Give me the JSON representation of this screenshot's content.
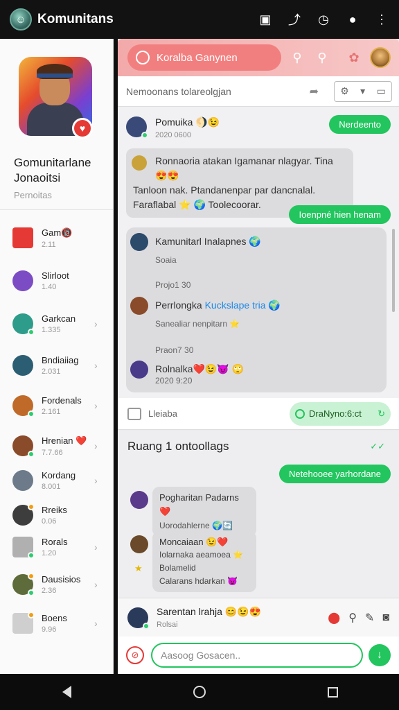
{
  "topbar": {
    "title": "Komunitans",
    "icons": [
      "camera-icon",
      "upload-icon",
      "timer-icon",
      "notification-icon",
      "more-icon"
    ]
  },
  "sidebar": {
    "profile_name": "Gomunitarlane Jonaoitsi",
    "profile_sub": "Pernoitas",
    "items": [
      {
        "name": "Gam🔞",
        "sub": "2.11",
        "color": "#e53935"
      },
      {
        "name": "Slirloot",
        "sub": "1.40",
        "color": "#7b4cc4"
      },
      {
        "name": "Garkcan",
        "sub": "1.335",
        "color": "#2e9c8a"
      },
      {
        "name": "Bndiaiiag",
        "sub": "2.031",
        "color": "#2c5e73"
      },
      {
        "name": "Fordenals",
        "sub": "2.161",
        "color": "#c06a2a"
      },
      {
        "name": "Hrenian ❤️",
        "sub": "7.7.66",
        "color": "#8a4b2a"
      },
      {
        "name": "Kordang",
        "sub": "8.001",
        "color": "#6c7a8a"
      },
      {
        "name": "Rreiks",
        "sub": "0.06",
        "color": "#3d3d3d"
      },
      {
        "name": "Rorals",
        "sub": "1.20",
        "color": "#a0a0a0"
      },
      {
        "name": "Dausisios",
        "sub": "2.36",
        "color": "#5e6b3a"
      },
      {
        "name": "Boens",
        "sub": "9.96",
        "color": "#b7b7b7"
      }
    ]
  },
  "main": {
    "search_text": "Koralba Ganynen",
    "filter_text": "Nemoonans tolareolgjan",
    "feed": {
      "msg1_sender": "Pomuika",
      "msg1_emoji": "🌖😉",
      "msg1_time": "2020 0600",
      "msg1_reply": "Nerdeento",
      "msg2_line1": "Ronnaoria atakan Igamanar nlagyar. Tina 😍😍",
      "msg2_line2": "Tanloon nak. Ptandanenpar par dancnalal.",
      "msg2_line3": "Faraflabal ⭐ 🌍 Toolecoorar.",
      "msg3_reply": "Ioenpné hien henam",
      "thread": {
        "title": "Kamunitarl Inalapnes 🌍",
        "title_sub": "Soaia",
        "time1": "Projo1 30",
        "sender2": "Perrlongka",
        "sender2_link": "Kuckslape tria",
        "sender2_emoji": "🌍",
        "sender2_sub": "Sanealiar nenpitarn ⭐",
        "time2": "Praon7 30",
        "sender3": "Rolnalka❤️😉😈",
        "sender3_emoji": "🙄",
        "sender3_time": "2020 9:20"
      },
      "reply_label": "Lleiaba",
      "reply_pill": "DraNyno:6:ct"
    },
    "room": {
      "title": "Ruang 1 ontoollags",
      "check": "✓✓",
      "out_reply": "Netehooee yarhordane",
      "msg1_title": "Pogharitan Padarns ❤️",
      "msg1_sub": "Uorodahlerne 🌍🔄",
      "msg2_title": "Moncaiaan 😉❤️",
      "msg2_line1": "Iolarnaka aeamoea ⭐",
      "msg2_line2": "Bolamelid",
      "msg2_line3": "Calarans hdarkan 😈"
    },
    "composer": {
      "sender": "Sarentan lrahja 😊😉😍",
      "sub": "Rolsai"
    },
    "input": {
      "placeholder": "Aasoog Gosacen.."
    }
  },
  "colors": {
    "accent_green": "#22c55e",
    "search_red": "#f27f7f"
  }
}
